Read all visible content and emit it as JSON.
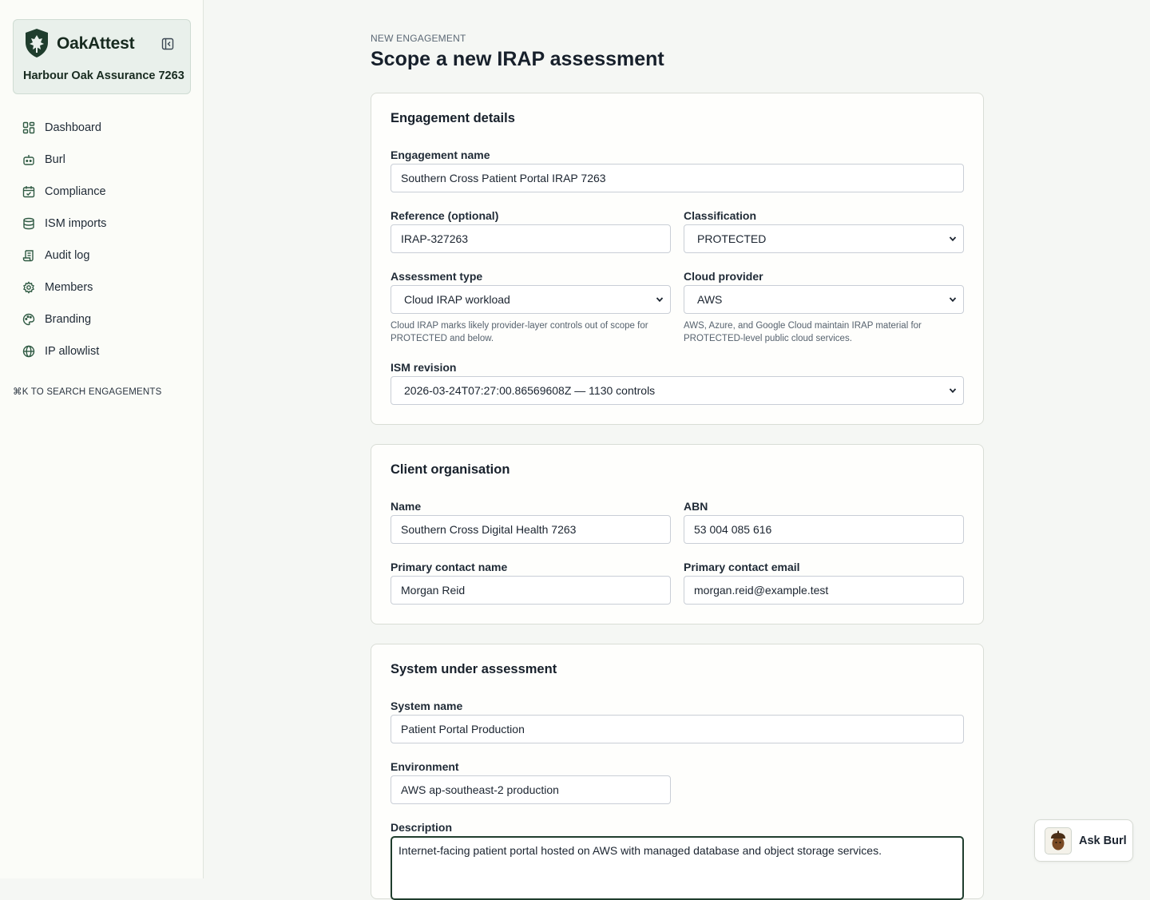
{
  "app": {
    "name": "OakAttest",
    "org": "Harbour Oak Assurance 7263"
  },
  "sidebar": {
    "items": [
      {
        "label": "Dashboard",
        "icon": "dashboard-icon"
      },
      {
        "label": "Burl",
        "icon": "bot-icon"
      },
      {
        "label": "Compliance",
        "icon": "calendar-check-icon"
      },
      {
        "label": "ISM imports",
        "icon": "database-icon"
      },
      {
        "label": "Audit log",
        "icon": "scroll-icon"
      },
      {
        "label": "Members",
        "icon": "gear-icon"
      },
      {
        "label": "Branding",
        "icon": "palette-icon"
      },
      {
        "label": "IP allowlist",
        "icon": "globe-icon"
      }
    ],
    "search_hint": "⌘K TO SEARCH ENGAGEMENTS"
  },
  "page": {
    "eyebrow": "NEW ENGAGEMENT",
    "title": "Scope a new IRAP assessment"
  },
  "engagement": {
    "title": "Engagement details",
    "name_label": "Engagement name",
    "name_value": "Southern Cross Patient Portal IRAP 7263",
    "reference_label": "Reference (optional)",
    "reference_value": "IRAP-327263",
    "classification_label": "Classification",
    "classification_value": "PROTECTED",
    "assessment_type_label": "Assessment type",
    "assessment_type_value": "Cloud IRAP workload",
    "assessment_type_help": "Cloud IRAP marks likely provider-layer controls out of scope for PROTECTED and below.",
    "cloud_provider_label": "Cloud provider",
    "cloud_provider_value": "AWS",
    "cloud_provider_help": "AWS, Azure, and Google Cloud maintain IRAP material for PROTECTED-level public cloud services.",
    "ism_label": "ISM revision",
    "ism_value": "2026-03-24T07:27:00.86569608Z — 1130 controls"
  },
  "client": {
    "title": "Client organisation",
    "name_label": "Name",
    "name_value": "Southern Cross Digital Health 7263",
    "abn_label": "ABN",
    "abn_value": "53 004 085 616",
    "contact_name_label": "Primary contact name",
    "contact_name_value": "Morgan Reid",
    "contact_email_label": "Primary contact email",
    "contact_email_value": "morgan.reid@example.test"
  },
  "system": {
    "title": "System under assessment",
    "name_label": "System name",
    "name_value": "Patient Portal Production",
    "env_label": "Environment",
    "env_value": "AWS ap-southeast-2 production",
    "desc_label": "Description",
    "desc_value": "Internet-facing patient portal hosted on AWS with managed database and object storage services."
  },
  "assistant": {
    "label": "Ask Burl"
  },
  "colors": {
    "accent": "#1f3d2d",
    "sidebar_bg": "#fbfcf8",
    "page_bg": "#f5f7f4"
  }
}
